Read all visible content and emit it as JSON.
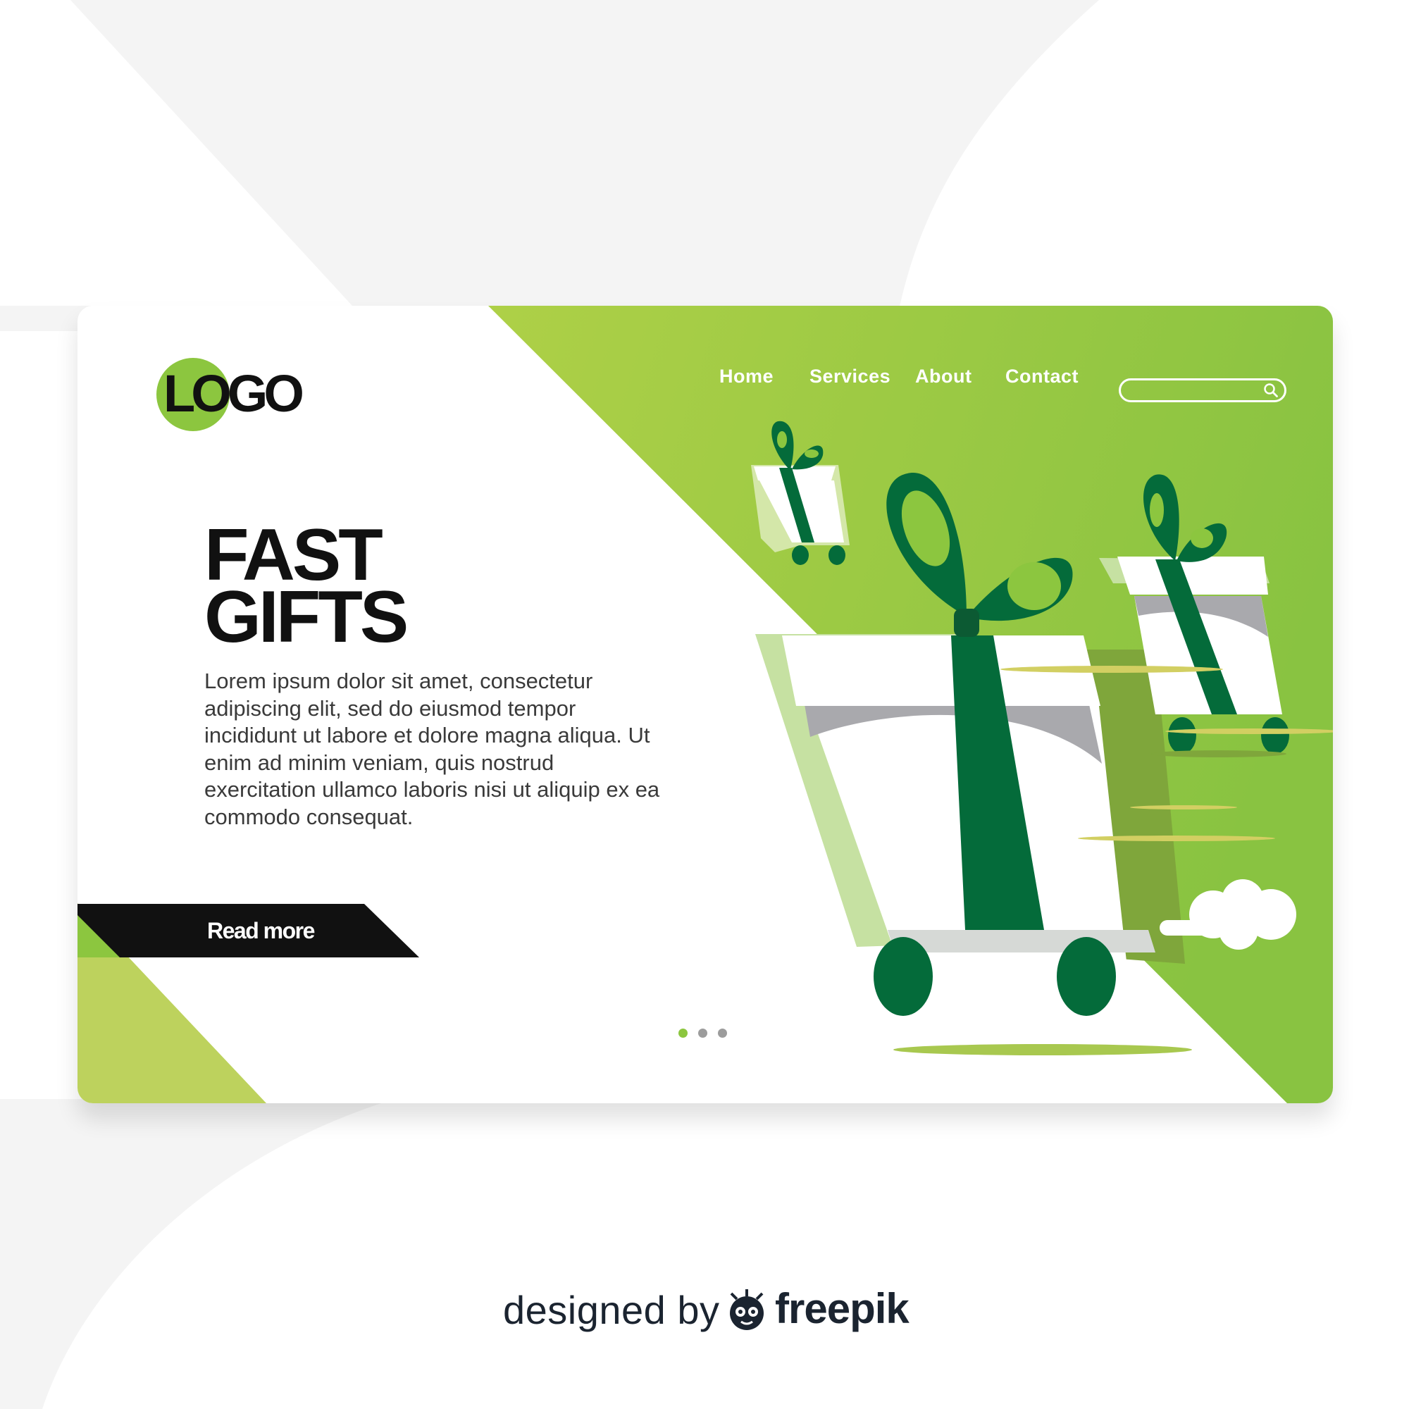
{
  "brand": {
    "logo_text": "LOGO"
  },
  "nav": {
    "items": [
      {
        "label": "Home"
      },
      {
        "label": "Services"
      },
      {
        "label": "About"
      },
      {
        "label": "Contact"
      }
    ]
  },
  "search": {
    "value": "",
    "placeholder": "",
    "icon": "search-icon"
  },
  "hero": {
    "title_line1": "FAST",
    "title_line2": "GIFTS",
    "body": "Lorem ipsum dolor sit amet, consectetur adipiscing elit, sed do eiusmod tempor incididunt ut labore et dolore magna aliqua. Ut enim ad minim veniam, quis nostrud exercitation ullamco laboris nisi ut aliquip ex ea commodo consequat.",
    "cta_label": "Read more"
  },
  "carousel": {
    "slides": 3,
    "active_index": 0
  },
  "attribution": {
    "prefix": "designed by",
    "brand": "freepik"
  },
  "colors": {
    "accent_green": "#8cc63f",
    "dark_green": "#046b3a",
    "light_green": "#b9d35a",
    "black": "#111111"
  }
}
